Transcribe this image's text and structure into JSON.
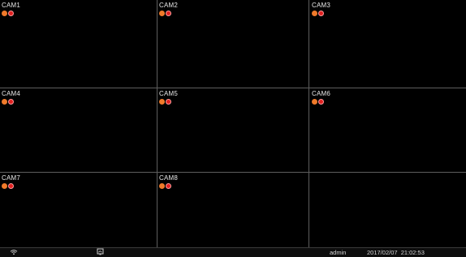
{
  "cameras": [
    {
      "label": "CAM1",
      "has_indicators": true
    },
    {
      "label": "CAM2",
      "has_indicators": true
    },
    {
      "label": "CAM3",
      "has_indicators": true
    },
    {
      "label": "CAM4",
      "has_indicators": true
    },
    {
      "label": "CAM5",
      "has_indicators": true
    },
    {
      "label": "CAM6",
      "has_indicators": true
    },
    {
      "label": "CAM7",
      "has_indicators": true
    },
    {
      "label": "CAM8",
      "has_indicators": true
    },
    {
      "label": "",
      "has_indicators": false
    }
  ],
  "indicators": {
    "record_color": "#f07a2a",
    "alarm_color": "#e02020"
  },
  "taskbar": {
    "user": "admin",
    "datetime": "2017/02/07  21:02:53",
    "left_icon": "wifi-icon",
    "second_icon": "image-icon"
  }
}
